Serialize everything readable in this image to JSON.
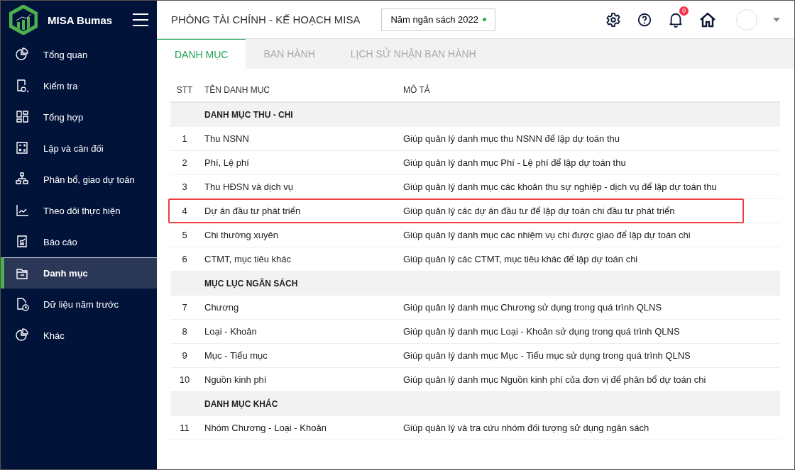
{
  "app": {
    "name": "MISA Bumas"
  },
  "sidebar": {
    "items": [
      {
        "label": "Tổng quan",
        "selected": false
      },
      {
        "label": "Kiểm tra",
        "selected": false
      },
      {
        "label": "Tổng hợp",
        "selected": false
      },
      {
        "label": "Lập và cân đối",
        "selected": false
      },
      {
        "label": "Phân bổ, giao dự toán",
        "selected": false
      },
      {
        "label": "Theo dõi thực hiện",
        "selected": false
      },
      {
        "label": "Báo cáo",
        "selected": false
      },
      {
        "label": "Danh mục",
        "selected": true
      },
      {
        "label": "Dữ liệu năm trước",
        "selected": false
      },
      {
        "label": "Khác",
        "selected": false
      }
    ]
  },
  "header": {
    "title": "PHÒNG TÀI CHÍNH - KẾ HOẠCH MISA",
    "budget_year": "Năm ngân sách 2022",
    "notification_count": "0"
  },
  "tabs": [
    {
      "label": "DANH MỤC",
      "selected": true
    },
    {
      "label": "BAN HÀNH",
      "selected": false
    },
    {
      "label": "LỊCH SỬ NHẬN BAN HÀNH",
      "selected": false
    }
  ],
  "table": {
    "columns": [
      "STT",
      "TÊN DANH MỤC",
      "MÔ TẢ"
    ],
    "rows": [
      {
        "kind": "group",
        "name": "DANH MỤC THU - CHI"
      },
      {
        "kind": "item",
        "stt": "1",
        "name": "Thu NSNN",
        "description": "Giúp quản lý danh mục thu NSNN để lập dự toán thu",
        "highlighted": false
      },
      {
        "kind": "item",
        "stt": "2",
        "name": "Phí, Lệ phí",
        "description": "Giúp quản lý danh mục Phí - Lệ phí để lập dự toán thu",
        "highlighted": false
      },
      {
        "kind": "item",
        "stt": "3",
        "name": "Thu HĐSN và dịch vụ",
        "description": "Giúp quản lý danh mục các khoản thu sự nghiệp - dịch vụ để lập dự toán thu",
        "highlighted": false
      },
      {
        "kind": "item",
        "stt": "4",
        "name": "Dự án đầu tư phát triển",
        "description": "Giúp quản lý các dự án đầu tư để lập dự toán chi đầu tư phát triển",
        "highlighted": true
      },
      {
        "kind": "item",
        "stt": "5",
        "name": "Chi thường xuyên",
        "description": "Giúp quản lý danh mục các nhiệm vụ chi được giao để lập dự toán chi",
        "highlighted": false
      },
      {
        "kind": "item",
        "stt": "6",
        "name": "CTMT, mục tiêu khác",
        "description": "Giúp quản lý các CTMT, mục tiêu khác để lập dự toán chi",
        "highlighted": false
      },
      {
        "kind": "group",
        "name": "MỤC LỤC NGÂN SÁCH"
      },
      {
        "kind": "item",
        "stt": "7",
        "name": "Chương",
        "description": "Giúp quản lý danh mục Chương sử dụng trong quá trình QLNS",
        "highlighted": false
      },
      {
        "kind": "item",
        "stt": "8",
        "name": "Loại - Khoản",
        "description": "Giúp quản lý danh mục Loại - Khoản sử dụng trong quá trình QLNS",
        "highlighted": false
      },
      {
        "kind": "item",
        "stt": "9",
        "name": "Mục - Tiểu mục",
        "description": "Giúp quản lý danh mục Mục - Tiểu mục sử dụng trong quá trình QLNS",
        "highlighted": false
      },
      {
        "kind": "item",
        "stt": "10",
        "name": "Nguồn kinh phí",
        "description": "Giúp quản lý danh mục Nguồn kinh phí của đơn vị để phân bổ dự toán chi",
        "highlighted": false
      },
      {
        "kind": "group",
        "name": "DANH MỤC KHÁC"
      },
      {
        "kind": "item",
        "stt": "11",
        "name": "Nhóm Chương - Loại - Khoản",
        "description": "Giúp quản lý và tra cứu nhóm đối tượng sử dụng ngân sách",
        "highlighted": false
      }
    ]
  }
}
